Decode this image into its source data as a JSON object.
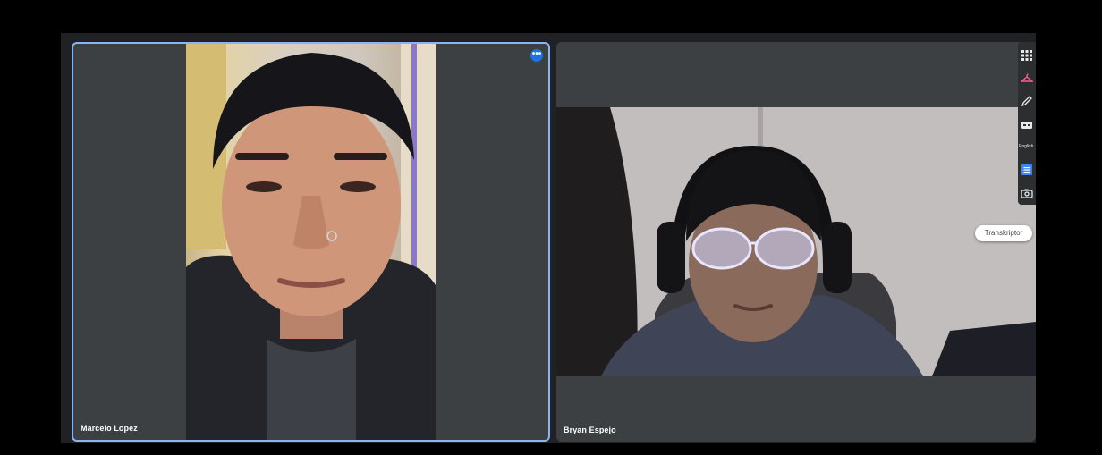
{
  "participants": [
    {
      "name": "Marcelo Lopez",
      "active_speaker": true
    },
    {
      "name": "Bryan Espejo",
      "active_speaker": false
    }
  ],
  "tile_menu": {
    "label": "•••"
  },
  "toolbar": {
    "icons": [
      "grid-icon",
      "hanger-icon",
      "pen-icon",
      "cc-icon",
      "notes-icon",
      "camera-icon"
    ],
    "language_label": "English"
  },
  "extension_badge": {
    "label": "Transkriptor"
  },
  "colors": {
    "active_border": "#8ab4f8",
    "menu_button": "#1a73e8",
    "tile_background": "#3c4043",
    "stage_background": "#202124"
  }
}
